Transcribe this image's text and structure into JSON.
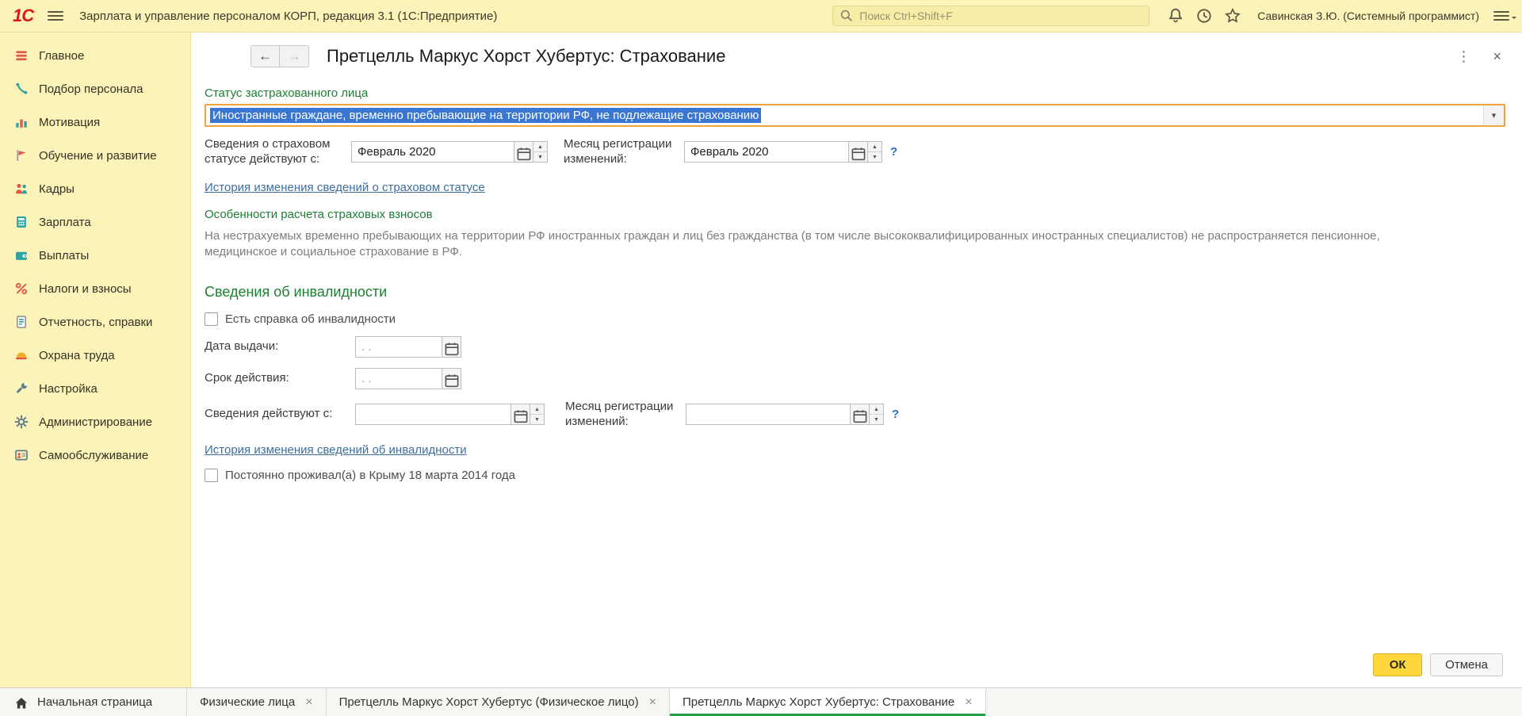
{
  "glyphs": {
    "back": "←",
    "forward": "→",
    "more": "⋮",
    "close": "×",
    "dropdown": "▾",
    "up": "▲",
    "down": "▼",
    "help": "?",
    "tab_close": "×"
  },
  "topbar": {
    "logo": "1С",
    "app_title": "Зарплата и управление персоналом КОРП, редакция 3.1  (1С:Предприятие)",
    "search_placeholder": "Поиск Ctrl+Shift+F",
    "user": "Савинская З.Ю. (Системный программист)"
  },
  "sidebar": {
    "items": [
      {
        "label": "Главное",
        "icon": "home-icon"
      },
      {
        "label": "Подбор персонала",
        "icon": "phone-icon"
      },
      {
        "label": "Мотивация",
        "icon": "bar-chart-icon"
      },
      {
        "label": "Обучение и развитие",
        "icon": "flag-icon"
      },
      {
        "label": "Кадры",
        "icon": "people-icon"
      },
      {
        "label": "Зарплата",
        "icon": "calculator-icon"
      },
      {
        "label": "Выплаты",
        "icon": "wallet-icon"
      },
      {
        "label": "Налоги и взносы",
        "icon": "percent-icon"
      },
      {
        "label": "Отчетность, справки",
        "icon": "report-icon"
      },
      {
        "label": "Охрана труда",
        "icon": "helmet-icon"
      },
      {
        "label": "Настройка",
        "icon": "wrench-icon"
      },
      {
        "label": "Администрирование",
        "icon": "gear-icon"
      },
      {
        "label": "Самообслуживание",
        "icon": "id-card-icon"
      }
    ]
  },
  "form": {
    "title": "Претцелль Маркус Хорст Хубертус: Страхование",
    "status_label": "Статус застрахованного лица",
    "status_value": "Иностранные граждане, временно пребывающие на территории РФ, не подлежащие страхованию",
    "valid_from_label": "Сведения о страховом статусе действуют с:",
    "valid_from_value": "Февраль 2020",
    "reg_month_label": "Месяц регистрации изменений:",
    "reg_month_value": "Февраль 2020",
    "status_history_link": "История изменения сведений о страховом статусе",
    "contrib_title": "Особенности расчета страховых взносов",
    "contrib_text": "На нестрахуемых временно пребывающих на территории РФ иностранных граждан и лиц без гражданства (в том числе высококвалифицированных иностранных специалистов) не распространяется пенсионное, медицинское и социальное страхование в РФ.",
    "disability_title": "Сведения об инвалидности",
    "has_cert_label": "Есть справка об инвалидности",
    "issue_date_label": "Дата выдачи:",
    "expiry_label": "Срок действия:",
    "info_from_label": "Сведения действуют с:",
    "reg_month2_label": "Месяц регистрации изменений:",
    "empty_date": ". .",
    "disability_history_link": "История изменения сведений об инвалидности",
    "crimea_label": "Постоянно проживал(а) в Крыму 18 марта 2014 года",
    "ok": "ОК",
    "cancel": "Отмена"
  },
  "tabs": {
    "home": "Начальная страница",
    "items": [
      {
        "label": "Физические лица",
        "active": false
      },
      {
        "label": "Претцелль Маркус Хорст Хубертус (Физическое лицо)",
        "active": false
      },
      {
        "label": "Претцелль Маркус Хорст Хубертус: Страхование",
        "active": true
      }
    ]
  }
}
